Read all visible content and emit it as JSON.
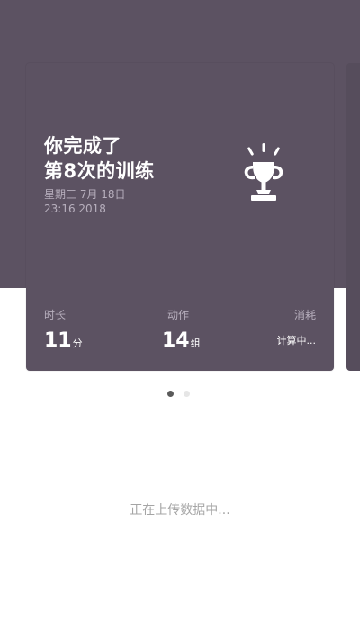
{
  "card": {
    "title_line1": "你完成了",
    "title_line2": "第8次的训练",
    "date_line1": "星期三 7月 18日",
    "date_line2": "23:16 2018",
    "icon": "trophy-icon"
  },
  "stats": {
    "duration": {
      "label": "时长",
      "value": "11",
      "unit": "分"
    },
    "actions": {
      "label": "动作",
      "value": "14",
      "unit": "组"
    },
    "calories": {
      "label": "消耗",
      "value": "计算中..."
    }
  },
  "pager": {
    "total": 2,
    "active": 1
  },
  "status": {
    "text": "正在上传数据中..."
  },
  "colors": {
    "header_bg": "#5c5262",
    "card_bg": "#5c5262",
    "muted_text": "#b7afbd",
    "status_text": "#a5a5a5"
  }
}
